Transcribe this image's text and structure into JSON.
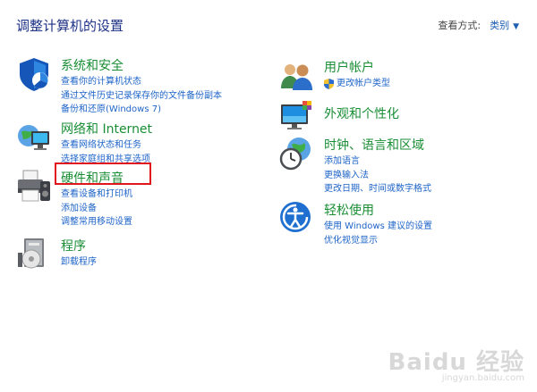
{
  "header": {
    "title": "调整计算机的设置",
    "view_by_label": "查看方式:",
    "view_by_value": "类别"
  },
  "left": [
    {
      "title": "系统和安全",
      "links": [
        "查看你的计算机状态",
        "通过文件历史记录保存你的文件备份副本",
        "备份和还原(Windows 7)"
      ]
    },
    {
      "title": "网络和 Internet",
      "links": [
        "查看网络状态和任务",
        "选择家庭组和共享选项"
      ]
    },
    {
      "title": "硬件和声音",
      "links": [
        "查看设备和打印机",
        "添加设备",
        "调整常用移动设置"
      ]
    },
    {
      "title": "程序",
      "links": [
        "卸载程序"
      ]
    }
  ],
  "right": [
    {
      "title": "用户帐户",
      "links": [
        "更改帐户类型"
      ]
    },
    {
      "title": "外观和个性化",
      "links": []
    },
    {
      "title": "时钟、语言和区域",
      "links": [
        "添加语言",
        "更换输入法",
        "更改日期、时间或数字格式"
      ]
    },
    {
      "title": "轻松使用",
      "links": [
        "使用 Windows 建议的设置",
        "优化视觉显示"
      ]
    }
  ],
  "watermark": {
    "title": "Baidu 经验",
    "url": "jingyan.baidu.com"
  },
  "colors": {
    "category": "#1a8e35",
    "link": "#1e64c8",
    "title": "#1e3287",
    "highlight": "#e0161c"
  }
}
